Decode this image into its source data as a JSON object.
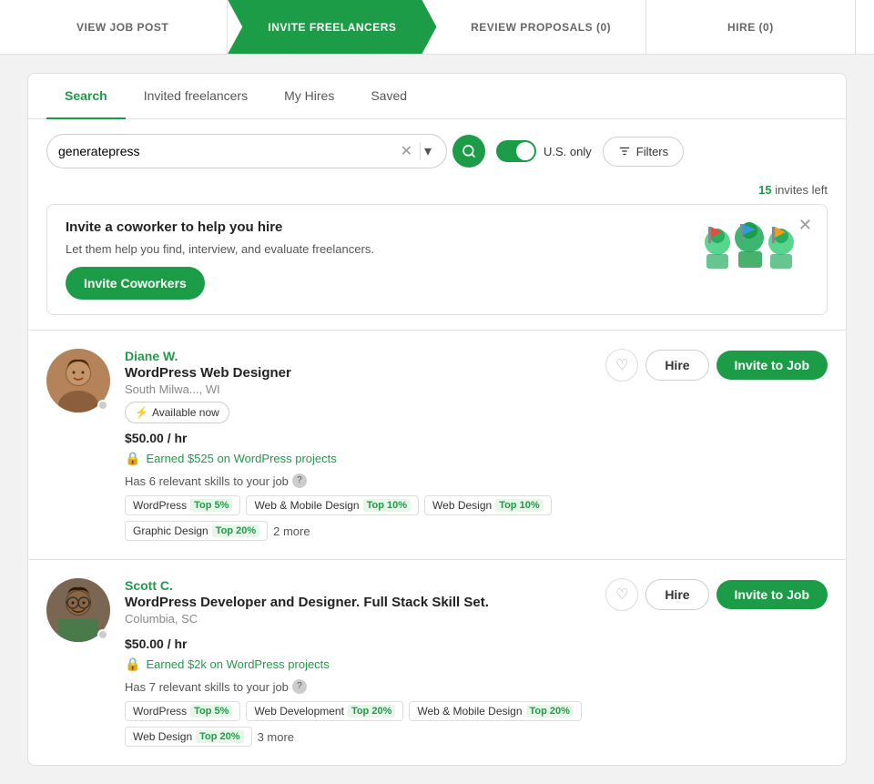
{
  "nav": {
    "steps": [
      {
        "id": "view-job-post",
        "label": "VIEW JOB POST",
        "active": false
      },
      {
        "id": "invite-freelancers",
        "label": "INVITE FREELANCERS",
        "active": true
      },
      {
        "id": "review-proposals",
        "label": "REVIEW PROPOSALS (0)",
        "active": false
      },
      {
        "id": "hire",
        "label": "HIRE (0)",
        "active": false
      }
    ]
  },
  "tabs": [
    {
      "id": "search",
      "label": "Search",
      "active": true
    },
    {
      "id": "invited-freelancers",
      "label": "Invited freelancers",
      "active": false
    },
    {
      "id": "my-hires",
      "label": "My Hires",
      "active": false
    },
    {
      "id": "saved",
      "label": "Saved",
      "active": false
    }
  ],
  "search": {
    "value": "generatepress",
    "placeholder": "Search",
    "us_only_label": "U.S. only",
    "filters_label": "Filters",
    "toggle_active": true
  },
  "invites": {
    "count": "15",
    "label": "invites left"
  },
  "invite_banner": {
    "title": "Invite a coworker to help you hire",
    "description": "Let them help you find, interview, and evaluate freelancers.",
    "button_label": "Invite Coworkers"
  },
  "freelancers": [
    {
      "id": "diane-w",
      "name": "Diane W.",
      "title": "WordPress Web Designer",
      "location": "South Milwa..., WI",
      "available": "Available now",
      "rate": "$50.00 / hr",
      "earnings": "Earned $525 on WordPress projects",
      "skills_summary": "Has 6 relevant skills to your job",
      "skills": [
        {
          "name": "WordPress",
          "badge": "Top 5%"
        },
        {
          "name": "Web & Mobile Design",
          "badge": "Top 10%"
        },
        {
          "name": "Web Design",
          "badge": "Top 10%"
        },
        {
          "name": "Graphic Design",
          "badge": "Top 20%"
        }
      ],
      "more_skills": "2 more",
      "hire_label": "Hire",
      "invite_label": "Invite to Job"
    },
    {
      "id": "scott-c",
      "name": "Scott C.",
      "title": "WordPress Developer and Designer. Full Stack Skill Set.",
      "location": "Columbia, SC",
      "available": null,
      "rate": "$50.00 / hr",
      "earnings": "Earned $2k on WordPress projects",
      "skills_summary": "Has 7 relevant skills to your job",
      "skills": [
        {
          "name": "WordPress",
          "badge": "Top 5%"
        },
        {
          "name": "Web Development",
          "badge": "Top 20%"
        },
        {
          "name": "Web & Mobile Design",
          "badge": "Top 20%"
        },
        {
          "name": "Web Design",
          "badge": "Top 20%"
        }
      ],
      "more_skills": "3 more",
      "hire_label": "Hire",
      "invite_label": "Invite to Job"
    }
  ]
}
